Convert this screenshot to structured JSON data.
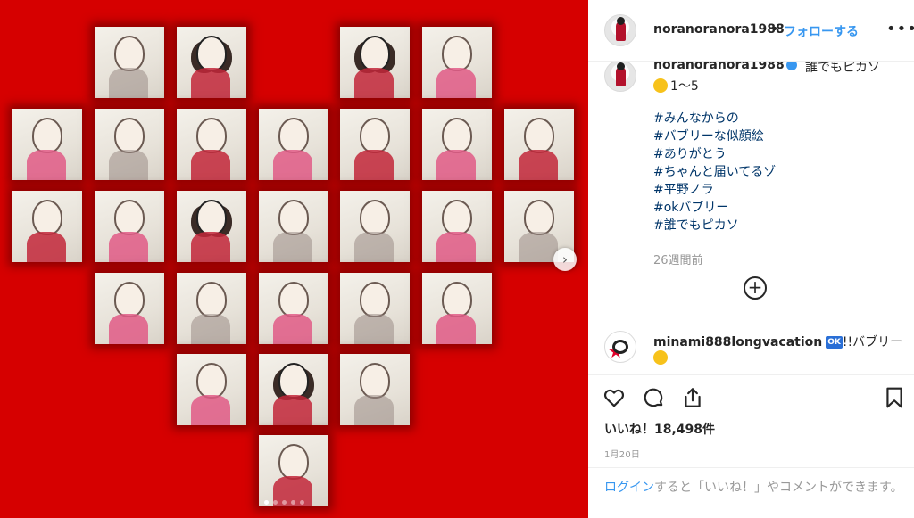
{
  "post": {
    "username": "noranoranora1988",
    "separator": "•",
    "follow_label": "フォローする",
    "more_label": "•••"
  },
  "caption": {
    "username": "noranoranora1988",
    "text_top": "誰でもピカソ",
    "line1_text": "1～5",
    "hashtags": [
      "#みんなからの",
      "#バブリーな似顔絵",
      "#ありがとう",
      "#ちゃんと届いてるゾ",
      "#平野ノラ",
      "#okバブリー",
      "#誰でもピカソ"
    ],
    "time_ago": "26週間前",
    "load_more_label": "+"
  },
  "comment": {
    "username": "minami888longvacation",
    "badge": "OK",
    "text": "!!バブリー"
  },
  "actions": {
    "likes_text": "いいね！18,498件",
    "date": "1月20日"
  },
  "login_prompt": {
    "link": "ログイン",
    "rest": "すると「いいね！」やコメントができます。"
  },
  "carousel": {
    "next_label": "›",
    "dot_count": 5,
    "active_dot": 0
  },
  "colors": {
    "background_red": "#d60000",
    "accent_blue": "#3897f0",
    "hashtag_blue": "#003569",
    "muted_gray": "#999999"
  }
}
